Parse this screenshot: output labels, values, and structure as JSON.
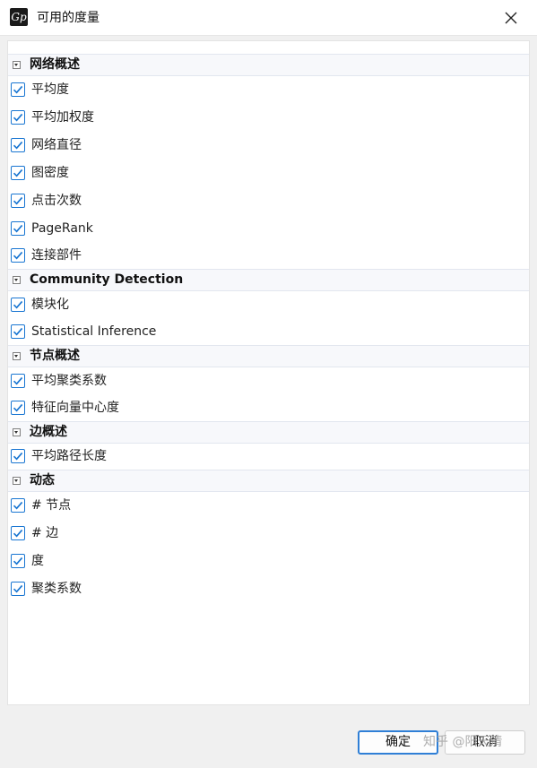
{
  "window": {
    "title": "可用的度量",
    "icon": "gephi-logo-icon",
    "icon_text": "Gp"
  },
  "categories": [
    {
      "label": "网络概述",
      "items": [
        {
          "label": "平均度",
          "checked": true
        },
        {
          "label": "平均加权度",
          "checked": true
        },
        {
          "label": "网络直径",
          "checked": true
        },
        {
          "label": "图密度",
          "checked": true
        },
        {
          "label": "点击次数",
          "checked": true
        },
        {
          "label": "PageRank",
          "checked": true
        },
        {
          "label": "连接部件",
          "checked": true
        }
      ]
    },
    {
      "label": "Community Detection",
      "items": [
        {
          "label": "模块化",
          "checked": true
        },
        {
          "label": "Statistical Inference",
          "checked": true
        }
      ]
    },
    {
      "label": "节点概述",
      "items": [
        {
          "label": "平均聚类系数",
          "checked": true
        },
        {
          "label": "特征向量中心度",
          "checked": true
        }
      ]
    },
    {
      "label": "边概述",
      "items": [
        {
          "label": "平均路径长度",
          "checked": true
        }
      ]
    },
    {
      "label": "动态",
      "items": [
        {
          "label": "# 节点",
          "checked": true
        },
        {
          "label": "# 边",
          "checked": true
        },
        {
          "label": "度",
          "checked": true
        },
        {
          "label": "聚类系数",
          "checked": true
        }
      ]
    }
  ],
  "buttons": {
    "ok_label": "确定",
    "cancel_label": "取消"
  },
  "watermark": "知乎 @阳天清",
  "colors": {
    "accent": "#1976d2",
    "ok_border": "#2f7fd6",
    "category_bg": "#f7f8fb"
  }
}
